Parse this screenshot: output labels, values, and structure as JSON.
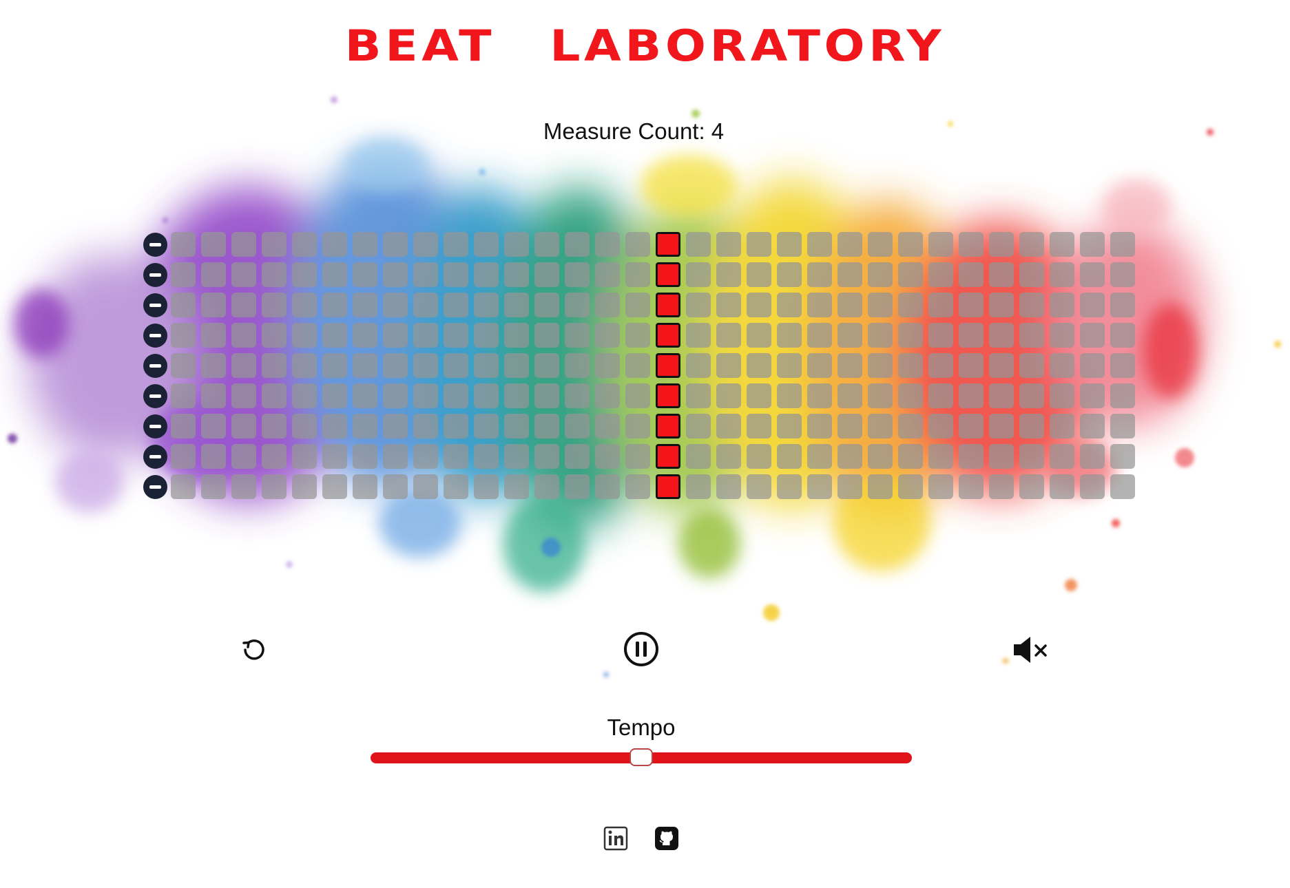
{
  "app": {
    "title": "BEAT LABORATORY"
  },
  "measure": {
    "label": "Measure Count: 4"
  },
  "sequencer": {
    "rows": 9,
    "columns": 32,
    "current_step_column": 16,
    "remove_row_icon": "minus-circle-icon"
  },
  "controls": {
    "reset_icon": "reset-icon",
    "pause_icon": "pause-circle-icon",
    "mute_icon": "speaker-muted-icon"
  },
  "tempo": {
    "label": "Tempo",
    "value_fraction": 0.5
  },
  "footer": {
    "links": [
      {
        "icon": "linkedin-icon"
      },
      {
        "icon": "github-icon"
      }
    ]
  },
  "colors": {
    "title": "#f0161c",
    "active_cell": "#f5141a",
    "inactive_cell": "#969696",
    "remove_button": "#1c2235",
    "tempo_track": "#e0121a"
  }
}
